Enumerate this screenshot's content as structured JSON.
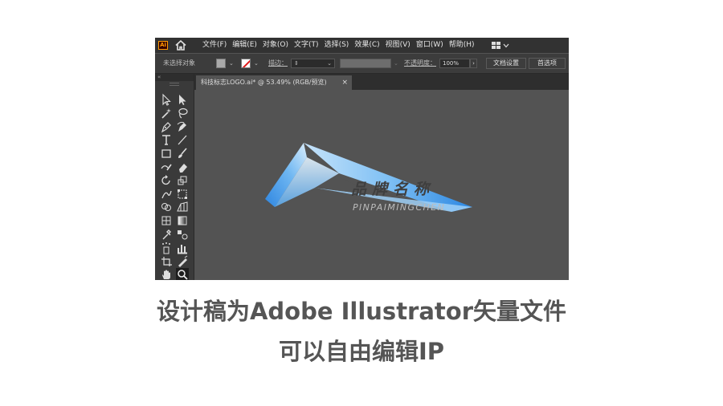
{
  "app": {
    "logo_text": "Ai"
  },
  "menu": [
    "文件(F)",
    "编辑(E)",
    "对象(O)",
    "文字(T)",
    "选择(S)",
    "效果(C)",
    "视图(V)",
    "窗口(W)",
    "帮助(H)"
  ],
  "control_bar": {
    "selection_status": "未选择对象",
    "stroke_label": "描边：",
    "opacity_label": "不透明度：",
    "opacity_value": "100%",
    "document_setup_button": "文档设置",
    "preferences_button": "首选项"
  },
  "tool_panel": {
    "header": "«"
  },
  "tools": [
    "selection-tool",
    "direct-selection-tool",
    "magic-wand-tool",
    "lasso-tool",
    "pen-tool",
    "curvature-tool",
    "type-tool",
    "line-tool",
    "rectangle-tool",
    "paintbrush-tool",
    "shaper-tool",
    "eraser-tool",
    "rotate-tool",
    "scale-tool",
    "warp-tool",
    "free-transform-tool",
    "shape-builder-tool",
    "perspective-grid-tool",
    "mesh-tool",
    "gradient-tool",
    "eyedropper-tool",
    "blend-tool",
    "symbol-sprayer-tool",
    "column-graph-tool",
    "artboard-tool",
    "slice-tool",
    "hand-tool",
    "zoom-tool"
  ],
  "document_tab": {
    "title": "科技标志LOGO.ai* @ 53.49% (RGB/预览)",
    "close": "×"
  },
  "artwork": {
    "brand_name": "品牌名称",
    "brand_pinyin": "PINPAIMINGCHEN",
    "colors": {
      "gradient_start": "#2f86e0",
      "gradient_mid": "#6fb7f2",
      "gradient_end": "#dbeefc",
      "text_dark": "#3f3f3f",
      "text_light": "#bcbcbc"
    }
  },
  "caption": {
    "line1": "设计稿为Adobe Illustrator矢量文件",
    "line2": "可以自由编辑IP"
  }
}
